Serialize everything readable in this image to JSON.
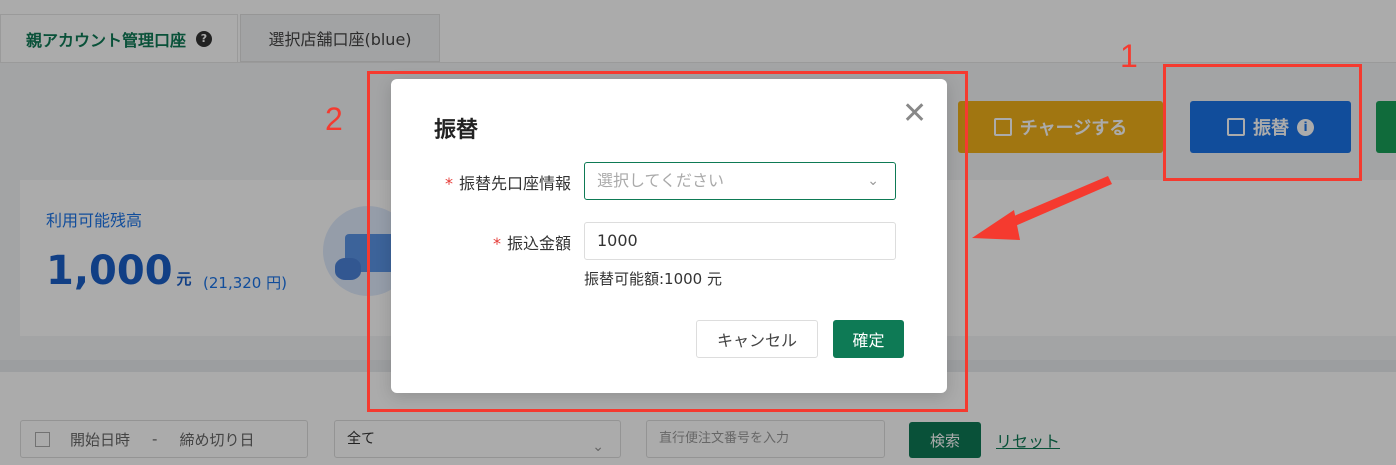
{
  "tabs": [
    {
      "label": "親アカウント管理口座",
      "active": true,
      "icon": "help-circle-icon"
    },
    {
      "label": "選択店舗口座(blue)",
      "active": false
    }
  ],
  "actions": {
    "charge_label": "チャージする",
    "transfer_label": "振替"
  },
  "balance": {
    "label": "利用可能残高",
    "amount": "1,000",
    "unit": "元",
    "yen": "(21,320 円)"
  },
  "filters": {
    "start_placeholder": "開始日時",
    "separator": "-",
    "end_placeholder": "締め切り日",
    "select_value": "全て",
    "order_placeholder": "直行便注文番号を入力",
    "search_label": "検索",
    "reset_label": "リセット"
  },
  "modal": {
    "title": "振替",
    "dest_label": "振替先口座情報",
    "dest_placeholder": "選択してください",
    "amount_label": "振込金額",
    "amount_value": "1000",
    "hint": "振替可能額:1000 元",
    "cancel_label": "キャンセル",
    "ok_label": "確定"
  },
  "annotations": {
    "label1": "1",
    "label2": "2",
    "color": "#f53a2f"
  },
  "colors": {
    "primary_green": "#0e7a55",
    "blue": "#1a73e8",
    "charge_yellow": "#f0b11a"
  }
}
